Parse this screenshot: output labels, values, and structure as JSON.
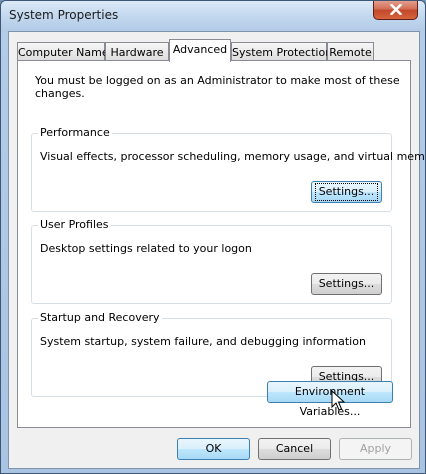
{
  "window": {
    "title": "System Properties",
    "close_icon": "close-icon"
  },
  "tabs": [
    {
      "label": "Computer Name"
    },
    {
      "label": "Hardware"
    },
    {
      "label": "Advanced",
      "selected": true
    },
    {
      "label": "System Protection"
    },
    {
      "label": "Remote"
    }
  ],
  "advanced": {
    "admin_note": "You must be logged on as an Administrator to make most of these changes.",
    "performance": {
      "title": "Performance",
      "description": "Visual effects, processor scheduling, memory usage, and virtual memory",
      "button": "Settings..."
    },
    "user_profiles": {
      "title": "User Profiles",
      "description": "Desktop settings related to your logon",
      "button": "Settings..."
    },
    "startup_recovery": {
      "title": "Startup and Recovery",
      "description": "System startup, system failure, and debugging information",
      "button": "Settings..."
    },
    "env_button": "Environment Variables..."
  },
  "footer": {
    "ok": "OK",
    "cancel": "Cancel",
    "apply": "Apply"
  },
  "colors": {
    "accent": "#3c7fb1",
    "close_red": "#c3482b"
  }
}
